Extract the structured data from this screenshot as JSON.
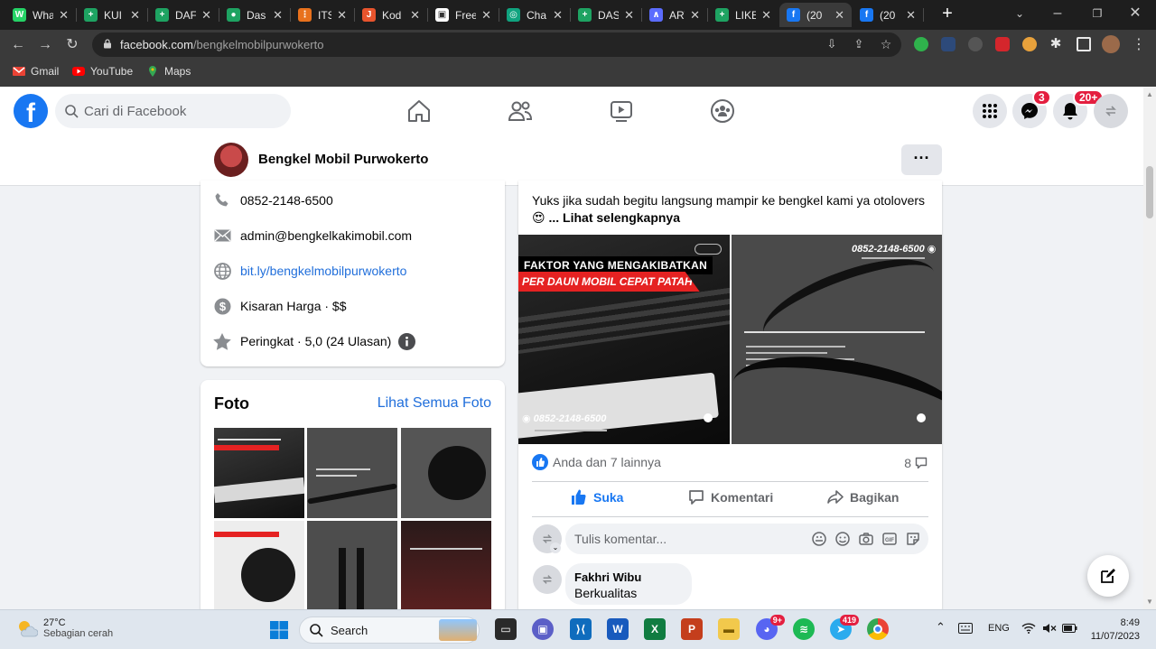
{
  "browser": {
    "tabs": [
      {
        "title": "WhatsApp",
        "color": "#25d366",
        "glyph": "W"
      },
      {
        "title": "KUI",
        "color": "#1ea362",
        "glyph": "+"
      },
      {
        "title": "DAF",
        "color": "#1ea362",
        "glyph": "+"
      },
      {
        "title": "Das",
        "color": "#1ea362",
        "glyph": "●"
      },
      {
        "title": "ITS",
        "color": "#e8711c",
        "glyph": "⋮"
      },
      {
        "title": "Kod",
        "color": "#e8542d",
        "glyph": "J"
      },
      {
        "title": "Free",
        "color": "#ffffff",
        "glyph": "▣"
      },
      {
        "title": "Cha",
        "color": "#10a37f",
        "glyph": "◎"
      },
      {
        "title": "DAS",
        "color": "#1ea362",
        "glyph": "+"
      },
      {
        "title": "ART",
        "color": "#5b6cff",
        "glyph": "∧"
      },
      {
        "title": "LIKE",
        "color": "#1ea362",
        "glyph": "+"
      },
      {
        "title": "(20",
        "color": "#1877f2",
        "glyph": "f",
        "active": true
      },
      {
        "title": "(20",
        "color": "#1877f2",
        "glyph": "f"
      }
    ],
    "url_host": "facebook.com",
    "url_path": "/bengkelmobilpurwokerto",
    "bookmarks": [
      "Gmail",
      "YouTube",
      "Maps"
    ]
  },
  "fb": {
    "search_placeholder": "Cari di Facebook",
    "messenger_badge": "3",
    "notif_badge": "20+",
    "page_name": "Bengkel Mobil Purwokerto",
    "more_label": "···",
    "intro": {
      "phone": "0852-2148-6500",
      "email": "admin@bengkelkakimobil.com",
      "website": "bit.ly/bengkelmobilpurwokerto",
      "price": "Kisaran Harga · $$",
      "rating": "Peringkat · 5,0 (24 Ulasan)"
    },
    "photos": {
      "title": "Foto",
      "see_all": "Lihat Semua Foto"
    },
    "post": {
      "text": "Yuks jika sudah begitu langsung mampir ke bengkel kami ya otolovers",
      "emoji": "😍",
      "see_more": "... Lihat selengkapnya",
      "image1_line1": "FAKTOR YANG MENGAKIBATKAN",
      "image1_line2": "PER DAUN MOBIL CEPAT PATAH",
      "image1_phone": "0852-2148-6500",
      "image2_phone": "0852-2148-6500",
      "reactions": "Anda dan 7 lainnya",
      "comment_count": "8",
      "like_label": "Suka",
      "comment_label": "Komentari",
      "share_label": "Bagikan",
      "comment_placeholder": "Tulis komentar...",
      "comment_author": "Fakhri Wibu",
      "comment_text": "Berkualitas"
    }
  },
  "taskbar": {
    "temp": "27°C",
    "weather": "Sebagian cerah",
    "search_label": "Search",
    "discord_badge": "9+",
    "telegram_badge": "419",
    "lang": "ENG",
    "time": "8:49",
    "date": "11/07/2023"
  }
}
